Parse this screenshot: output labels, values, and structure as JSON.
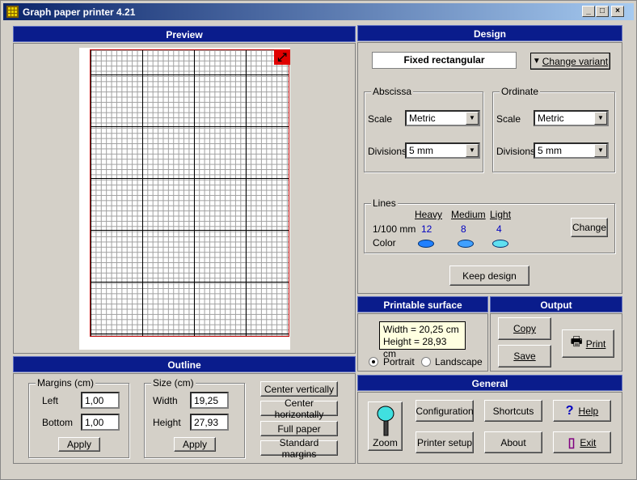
{
  "window": {
    "title": "Graph paper printer 4.21"
  },
  "preview": {
    "header": "Preview"
  },
  "design": {
    "header": "Design",
    "variant": "Fixed rectangular",
    "change_variant": "Change variant",
    "abscissa": {
      "label": "Abscissa",
      "scale_label": "Scale",
      "scale_value": "Metric",
      "divisions_label": "Divisions",
      "divisions_value": "5 mm"
    },
    "ordinate": {
      "label": "Ordinate",
      "scale_label": "Scale",
      "scale_value": "Metric",
      "divisions_label": "Divisions",
      "divisions_value": "5 mm"
    },
    "lines": {
      "label": "Lines",
      "unit_label": "1/100 mm",
      "color_label": "Color",
      "heavy": {
        "label": "Heavy",
        "value": "12",
        "color": "#2080ff"
      },
      "medium": {
        "label": "Medium",
        "value": "8",
        "color": "#40a0ff"
      },
      "light": {
        "label": "Light",
        "value": "4",
        "color": "#60e0f0"
      },
      "change": "Change"
    },
    "keep_design": "Keep design"
  },
  "printable": {
    "header": "Printable surface",
    "width_text": "Width = 20,25 cm",
    "height_text": "Height = 28,93 cm",
    "portrait": "Portrait",
    "landscape": "Landscape"
  },
  "output": {
    "header": "Output",
    "copy": "Copy",
    "save": "Save",
    "print": "Print"
  },
  "outline": {
    "header": "Outline",
    "margins": {
      "label": "Margins (cm)",
      "left_label": "Left",
      "left_value": "1,00",
      "bottom_label": "Bottom",
      "bottom_value": "1,00",
      "apply": "Apply"
    },
    "size": {
      "label": "Size (cm)",
      "width_label": "Width",
      "width_value": "19,25",
      "height_label": "Height",
      "height_value": "27,93",
      "apply": "Apply"
    },
    "center_vertically": "Center vertically",
    "center_horizontally": "Center horizontally",
    "full_paper": "Full paper",
    "standard_margins": "Standard margins"
  },
  "general": {
    "header": "General",
    "zoom": "Zoom",
    "configuration": "Configuration",
    "shortcuts": "Shortcuts",
    "help": "Help",
    "printer_setup": "Printer setup",
    "about": "About",
    "exit": "Exit"
  }
}
